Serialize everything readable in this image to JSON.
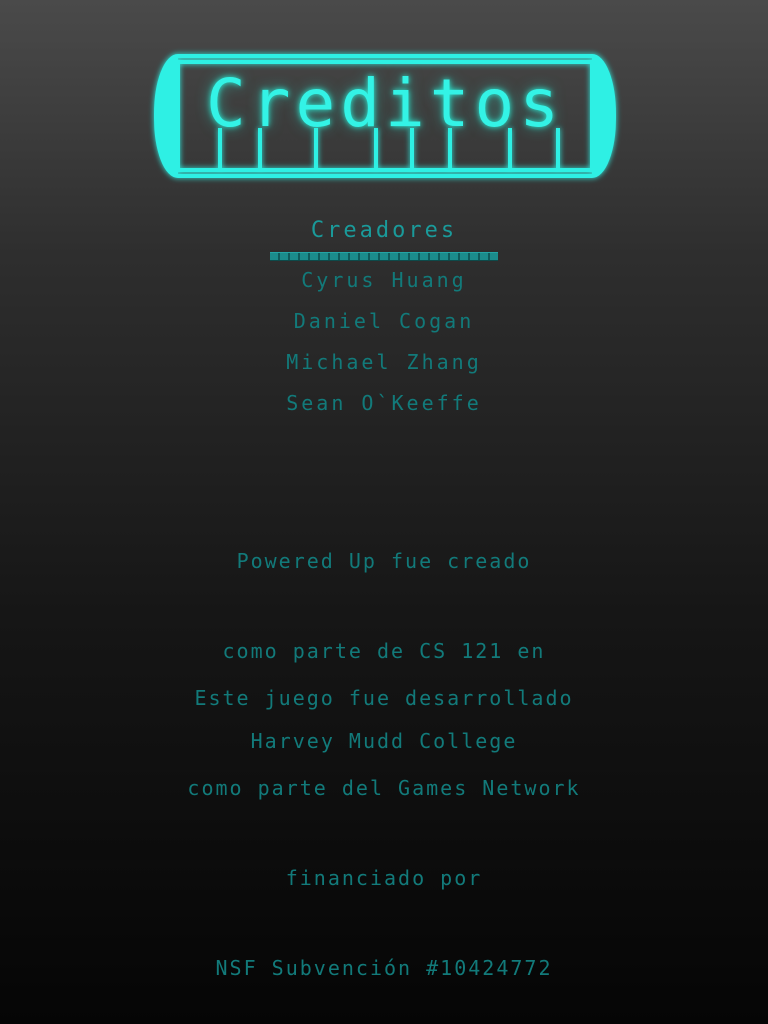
{
  "title": "Creditos",
  "creators": {
    "heading": "Creadores",
    "names": [
      "Cyrus Huang",
      "Daniel Cogan",
      "Michael Zhang",
      "Sean O`Keeffe"
    ]
  },
  "course_note": {
    "lines": [
      "Powered Up fue creado",
      "como parte de CS 121 en",
      "Harvey Mudd College"
    ]
  },
  "funding_note": {
    "lines": [
      "Este juego fue desarrollado",
      "como parte del Games Network",
      "financiado por",
      "NSF Subvención #10424772"
    ]
  },
  "colors": {
    "title_glow": "#33f3e6",
    "body_text": "#127a7a"
  }
}
